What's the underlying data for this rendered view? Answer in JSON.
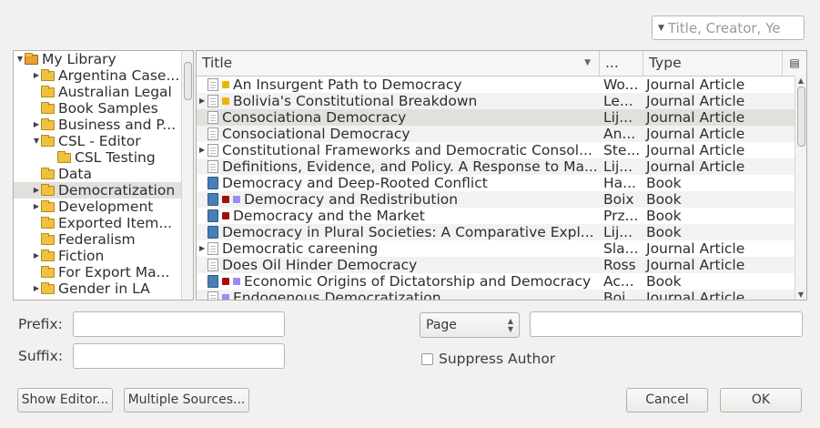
{
  "search": {
    "placeholder": "Title, Creator, Ye"
  },
  "tree": {
    "items": [
      {
        "label": "My Library",
        "twisty": "▼",
        "level": 0,
        "lib": true
      },
      {
        "label": "Argentina Case...",
        "twisty": "▶",
        "level": 1
      },
      {
        "label": "Australian Legal",
        "twisty": "",
        "level": 1
      },
      {
        "label": "Book Samples",
        "twisty": "",
        "level": 1
      },
      {
        "label": "Business and P...",
        "twisty": "▶",
        "level": 1
      },
      {
        "label": "CSL - Editor",
        "twisty": "▼",
        "level": 1
      },
      {
        "label": "CSL Testing",
        "twisty": "",
        "level": 2
      },
      {
        "label": "Data",
        "twisty": "",
        "level": 1
      },
      {
        "label": "Democratization",
        "twisty": "▶",
        "level": 1,
        "selected": true
      },
      {
        "label": "Development",
        "twisty": "▶",
        "level": 1
      },
      {
        "label": "Exported Item...",
        "twisty": "",
        "level": 1
      },
      {
        "label": "Federalism",
        "twisty": "",
        "level": 1
      },
      {
        "label": "Fiction",
        "twisty": "▶",
        "level": 1
      },
      {
        "label": "For Export Ma...",
        "twisty": "",
        "level": 1
      },
      {
        "label": "Gender in LA",
        "twisty": "▶",
        "level": 1
      }
    ]
  },
  "columns": {
    "title": "Title",
    "creator": "...",
    "type": "Type",
    "sort_icon": "▼",
    "picker_icon": "column-picker-icon"
  },
  "items": [
    {
      "twisty": "",
      "icon": "article",
      "tags": [
        "#e8b800"
      ],
      "title": "An Insurgent Path to Democracy",
      "creator": "Wo...",
      "type": "Journal Article"
    },
    {
      "twisty": "▶",
      "icon": "article",
      "tags": [
        "#e8b800"
      ],
      "title": "Bolivia's Constitutional Breakdown",
      "creator": "Le...",
      "type": "Journal Article"
    },
    {
      "twisty": "",
      "icon": "article",
      "tags": [],
      "title": "Consociationa Democracy",
      "creator": "Lij...",
      "type": "Journal Article",
      "selected": true
    },
    {
      "twisty": "",
      "icon": "article",
      "tags": [],
      "title": "Consociational Democracy",
      "creator": "An...",
      "type": "Journal Article"
    },
    {
      "twisty": "▶",
      "icon": "article",
      "tags": [],
      "title": "Constitutional Frameworks and Democratic Consol...",
      "creator": "Ste...",
      "type": "Journal Article"
    },
    {
      "twisty": "",
      "icon": "article",
      "tags": [],
      "title": "Definitions, Evidence, and Policy. A Response to Ma...",
      "creator": "Lij...",
      "type": "Journal Article"
    },
    {
      "twisty": "",
      "icon": "book",
      "tags": [],
      "title": "Democracy and Deep-Rooted Conflict",
      "creator": "Ha...",
      "type": "Book"
    },
    {
      "twisty": "",
      "icon": "book",
      "tags": [
        "#a01010",
        "#9a8cf0"
      ],
      "title": "Democracy and Redistribution",
      "creator": "Boix",
      "type": "Book"
    },
    {
      "twisty": "",
      "icon": "book",
      "tags": [
        "#a01010"
      ],
      "title": "Democracy and the Market",
      "creator": "Prz...",
      "type": "Book"
    },
    {
      "twisty": "",
      "icon": "book",
      "tags": [],
      "title": "Democracy in Plural Societies: A Comparative Expl...",
      "creator": "Lij...",
      "type": "Book"
    },
    {
      "twisty": "▶",
      "icon": "article",
      "tags": [],
      "title": "Democratic careening",
      "creator": "Sla...",
      "type": "Journal Article"
    },
    {
      "twisty": "",
      "icon": "article",
      "tags": [],
      "title": "Does Oil Hinder Democracy",
      "creator": "Ross",
      "type": "Journal Article"
    },
    {
      "twisty": "",
      "icon": "book",
      "tags": [
        "#a01010",
        "#9a8cf0"
      ],
      "title": "Economic Origins of Dictatorship and Democracy",
      "creator": "Ac...",
      "type": "Book"
    },
    {
      "twisty": "",
      "icon": "article",
      "tags": [
        "#9a8cf0"
      ],
      "title": "Endogenous Democratization",
      "creator": "Boi...",
      "type": "Journal Article"
    }
  ],
  "form": {
    "prefix_label": "Prefix:",
    "suffix_label": "Suffix:",
    "prefix_value": "",
    "suffix_value": "",
    "locator_label": "Page",
    "locator_value": "",
    "suppress_author_label": "Suppress Author",
    "suppress_author_checked": false
  },
  "buttons": {
    "show_editor": "Show Editor...",
    "multiple_sources": "Multiple Sources...",
    "cancel": "Cancel",
    "ok": "OK"
  }
}
